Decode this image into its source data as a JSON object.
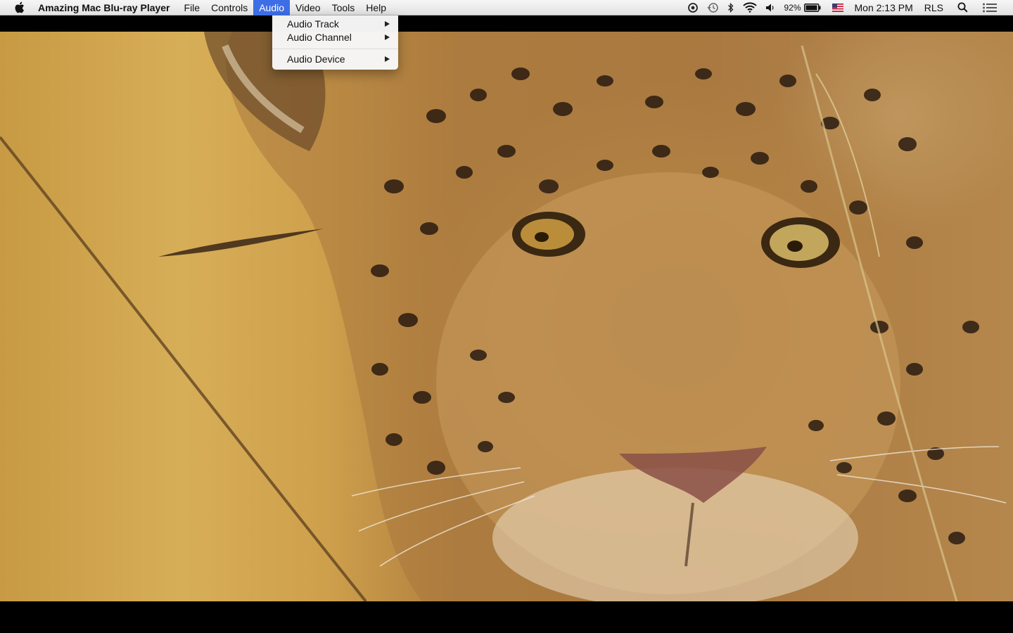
{
  "menubar": {
    "apple_icon": "apple-icon",
    "app_name": "Amazing Mac Blu-ray Player",
    "menus": [
      "File",
      "Controls",
      "Audio",
      "Video",
      "Tools",
      "Help"
    ],
    "active_menu": "Audio",
    "status": {
      "battery_percent": "92%",
      "clock": "Mon 2:13 PM",
      "user": "RLS",
      "icons": [
        "screen-record-icon",
        "time-machine-icon",
        "bluetooth-icon",
        "wifi-icon",
        "volume-icon",
        "battery-icon",
        "us-flag-icon",
        "spotlight-icon",
        "notification-center-icon"
      ]
    },
    "accent_color": "#3d6ee6"
  },
  "audio_menu": {
    "items": [
      {
        "label": "Audio Track",
        "has_submenu": true
      },
      {
        "label": "Audio Channel",
        "has_submenu": true
      },
      {
        "label": "Audio Device",
        "has_submenu": true
      }
    ]
  },
  "video": {
    "content": "leopard-closeup-frame",
    "letterbox_color": "#000000"
  }
}
